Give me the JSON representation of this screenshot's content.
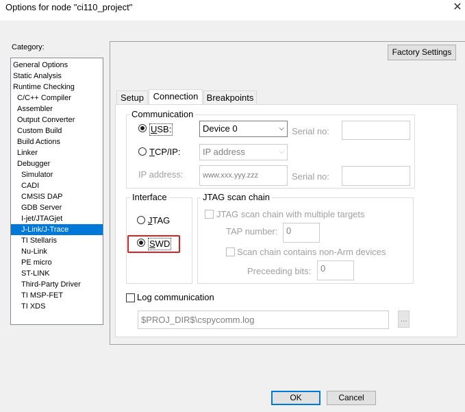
{
  "window": {
    "title": "Options for node \"ci110_project\"",
    "close_glyph": "✕"
  },
  "category": {
    "label": "Category:",
    "items": [
      {
        "label": "General Options",
        "indent": 0
      },
      {
        "label": "Static Analysis",
        "indent": 0
      },
      {
        "label": "Runtime Checking",
        "indent": 0
      },
      {
        "label": "C/C++ Compiler",
        "indent": 1
      },
      {
        "label": "Assembler",
        "indent": 1
      },
      {
        "label": "Output Converter",
        "indent": 1
      },
      {
        "label": "Custom Build",
        "indent": 1
      },
      {
        "label": "Build Actions",
        "indent": 1
      },
      {
        "label": "Linker",
        "indent": 1
      },
      {
        "label": "Debugger",
        "indent": 1
      },
      {
        "label": "Simulator",
        "indent": 2
      },
      {
        "label": "CADI",
        "indent": 2
      },
      {
        "label": "CMSIS DAP",
        "indent": 2
      },
      {
        "label": "GDB Server",
        "indent": 2
      },
      {
        "label": "I-jet/JTAGjet",
        "indent": 2
      },
      {
        "label": "J-Link/J-Trace",
        "indent": 2,
        "selected": true
      },
      {
        "label": "TI Stellaris",
        "indent": 2
      },
      {
        "label": "Nu-Link",
        "indent": 2
      },
      {
        "label": "PE micro",
        "indent": 2
      },
      {
        "label": "ST-LINK",
        "indent": 2
      },
      {
        "label": "Third-Party Driver",
        "indent": 2
      },
      {
        "label": "TI MSP-FET",
        "indent": 2
      },
      {
        "label": "TI XDS",
        "indent": 2
      }
    ]
  },
  "factory_settings": "Factory Settings",
  "tabs": [
    "Setup",
    "Connection",
    "Breakpoints"
  ],
  "communication": {
    "title": "Communication",
    "usb_label": "USB:",
    "usb_device": "Device 0",
    "serial_no_label": "Serial no:",
    "tcpip_label": "TCP/IP:",
    "ip_placeholder": "IP address",
    "ip_address_label": "IP address:",
    "ip_example": "www.xxx.yyy.zzz",
    "serial_no_label2": "Serial no:"
  },
  "interface": {
    "title": "Interface",
    "jtag": "JTAG",
    "swd": "SWD",
    "selected": "SWD"
  },
  "jtag_chain": {
    "title": "JTAG scan chain",
    "multi_targets": "JTAG scan chain with multiple targets",
    "tap_number_label": "TAP number:",
    "tap_number": "0",
    "non_arm": "Scan chain contains non-Arm devices",
    "preceding_bits_label": "Preceeding bits:",
    "preceding_bits": "0"
  },
  "log": {
    "label": "Log communication",
    "path": "$PROJ_DIR$\\cspycomm.log",
    "browse": "..."
  },
  "buttons": {
    "ok": "OK",
    "cancel": "Cancel"
  }
}
